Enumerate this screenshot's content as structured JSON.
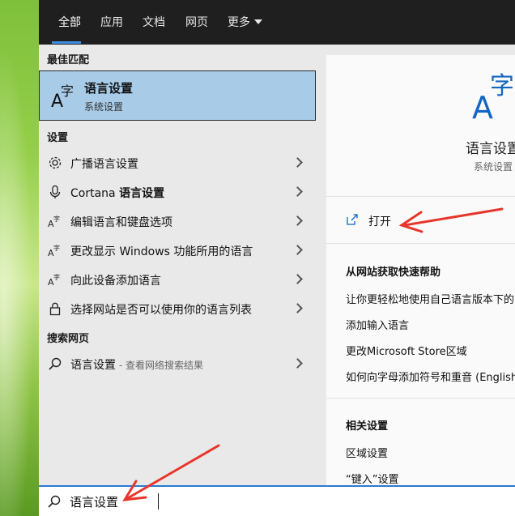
{
  "tabs": [
    {
      "label": "全部"
    },
    {
      "label": "应用"
    },
    {
      "label": "文档"
    },
    {
      "label": "网页"
    },
    {
      "label": "更多"
    }
  ],
  "left": {
    "best_match_label": "最佳匹配",
    "best_match": {
      "title": "语言设置",
      "subtitle": "系统设置"
    },
    "settings_label": "设置",
    "settings_items": [
      {
        "label": "广播语言设置",
        "icon": "gear-icon"
      },
      {
        "prefix": "Cortana ",
        "label": "语言设置",
        "icon": "microphone-icon"
      },
      {
        "label": "编辑语言和键盘选项",
        "icon": "language-icon"
      },
      {
        "label": "更改显示 Windows 功能所用的语言",
        "icon": "language-icon"
      },
      {
        "label": "向此设备添加语言",
        "icon": "language-icon"
      },
      {
        "label": "选择网站是否可以使用你的语言列表",
        "icon": "lock-icon"
      }
    ],
    "web_label": "搜索网页",
    "web_item": {
      "label": "语言设置",
      "hint": " - 查看网络搜索结果"
    }
  },
  "right": {
    "title": "语言设置",
    "subtitle": "系统设置",
    "open_label": "打开",
    "help_heading": "从网站获取快速帮助",
    "help_links": [
      "让你更轻松地使用自己语言版本下的",
      "添加输入语言",
      "更改Microsoft Store区域",
      "如何向字母添加符号和重音 (English"
    ],
    "related_heading": "相关设置",
    "related_links": [
      "区域设置",
      "“键入”设置"
    ]
  },
  "search": {
    "value": "语言设置"
  },
  "colors": {
    "accent": "#3d8ee6",
    "selection": "#a8cbe8",
    "annotation": "#e8352b"
  }
}
